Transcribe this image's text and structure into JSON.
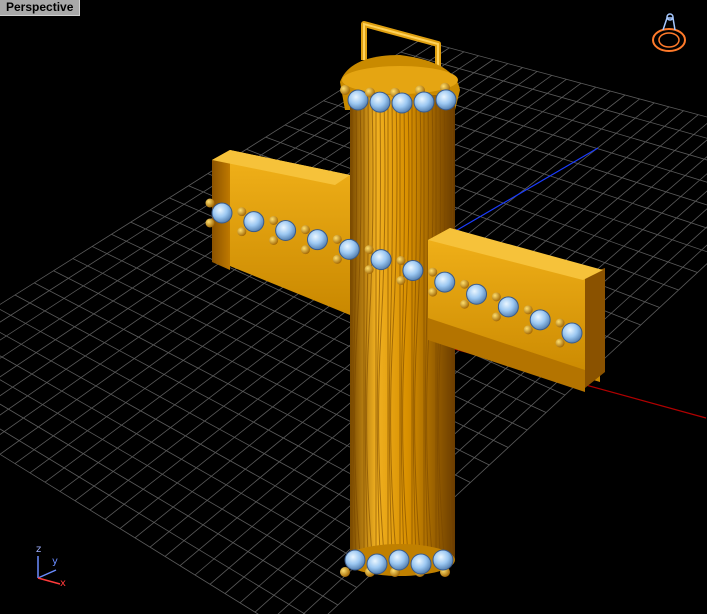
{
  "viewport": {
    "label": "Perspective",
    "background": "#000000",
    "grid_color": "#5a5a5a",
    "x_axis_color": "#b00000",
    "y_axis_color": "#1a3cff",
    "model_color": "#e0a00a",
    "gem_color": "#a8d4ff"
  },
  "axis_tripod": {
    "x": "x",
    "y": "y",
    "z": "z"
  },
  "viewcube": {
    "icon": "ring-navigation-icon"
  }
}
